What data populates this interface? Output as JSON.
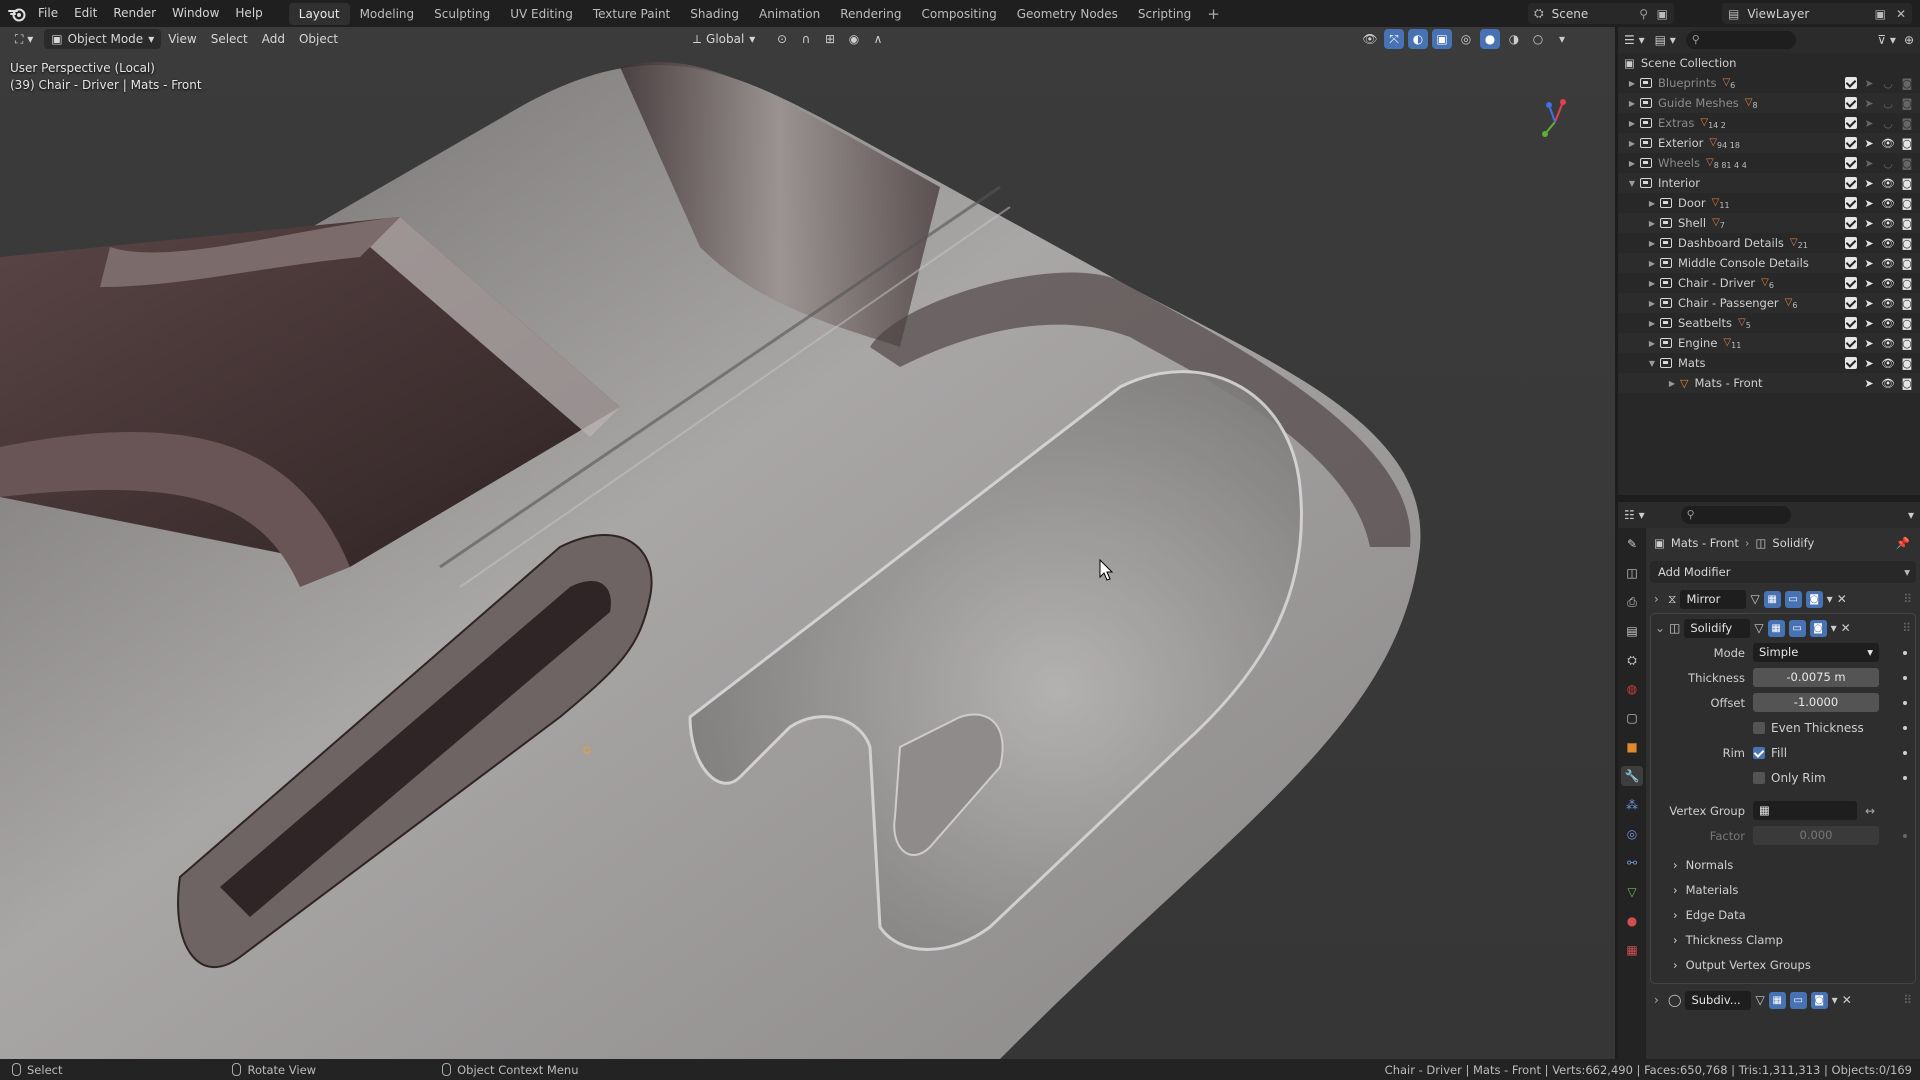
{
  "menu": {
    "items": [
      "File",
      "Edit",
      "Render",
      "Window",
      "Help"
    ]
  },
  "workspaces": [
    "Layout",
    "Modeling",
    "Sculpting",
    "UV Editing",
    "Texture Paint",
    "Shading",
    "Animation",
    "Rendering",
    "Compositing",
    "Geometry Nodes",
    "Scripting"
  ],
  "active_workspace": "Layout",
  "scene": {
    "name": "Scene",
    "view_layer": "ViewLayer"
  },
  "viewport": {
    "mode": "Object Mode",
    "menus": [
      "View",
      "Select",
      "Add",
      "Object"
    ],
    "orientation": "Global",
    "perspective_label": "User Perspective (Local)",
    "object_label": "(39) Chair - Driver | Mats - Front"
  },
  "outliner": {
    "title": "Scene Collection",
    "rows": [
      {
        "name": "Blueprints",
        "badge": "6",
        "dim": true,
        "indent": 0
      },
      {
        "name": "Guide Meshes",
        "badge": "8",
        "dim": true,
        "indent": 0
      },
      {
        "name": "Extras",
        "badge": "14  2",
        "dim": true,
        "indent": 0
      },
      {
        "name": "Exterior",
        "badge": "94 18",
        "dim": false,
        "indent": 0
      },
      {
        "name": "Wheels",
        "badge": "8 81 4 4",
        "dim": true,
        "indent": 0
      },
      {
        "name": "Interior",
        "badge": "",
        "dim": false,
        "indent": 0,
        "expanded": true
      },
      {
        "name": "Door",
        "badge": "11",
        "dim": false,
        "indent": 1
      },
      {
        "name": "Shell",
        "badge": "7",
        "dim": false,
        "indent": 1
      },
      {
        "name": "Dashboard Details",
        "badge": "21",
        "dim": false,
        "indent": 1
      },
      {
        "name": "Middle Console Details",
        "badge": "",
        "dim": false,
        "indent": 1
      },
      {
        "name": "Chair - Driver",
        "badge": "6",
        "dim": false,
        "indent": 1
      },
      {
        "name": "Chair - Passenger",
        "badge": "6",
        "dim": false,
        "indent": 1
      },
      {
        "name": "Seatbelts",
        "badge": "5",
        "dim": false,
        "indent": 1
      },
      {
        "name": "Engine",
        "badge": "11",
        "dim": false,
        "indent": 1
      },
      {
        "name": "Mats",
        "badge": "",
        "dim": false,
        "indent": 1,
        "expanded": true
      },
      {
        "name": "Mats - Front",
        "badge": "",
        "dim": false,
        "indent": 2,
        "object": true
      }
    ]
  },
  "properties": {
    "object": "Mats - Front",
    "modifier_context": "Solidify",
    "add_modifier": "Add Modifier",
    "modifiers": [
      "Mirror",
      "Solidify",
      "Subdiv..."
    ],
    "solidify": {
      "mode_label": "Mode",
      "mode_value": "Simple",
      "thickness_label": "Thickness",
      "thickness_value": "-0.0075 m",
      "offset_label": "Offset",
      "offset_value": "-1.0000",
      "even_thickness": "Even Thickness",
      "rim_label": "Rim",
      "fill": "Fill",
      "only_rim": "Only Rim",
      "vertex_group_label": "Vertex Group",
      "factor_label": "Factor",
      "factor_value": "0.000",
      "subpanels": [
        "Normals",
        "Materials",
        "Edge Data",
        "Thickness Clamp",
        "Output Vertex Groups"
      ]
    }
  },
  "statusbar": {
    "select": "Select",
    "rotate": "Rotate View",
    "context": "Object Context Menu",
    "stats": "Chair - Driver | Mats - Front | Verts:662,490 | Faces:650,768 | Tris:1,311,313 | Objects:0/169"
  },
  "colors": {
    "accent": "#4772b3",
    "badge": "#e08040",
    "background": "#393939"
  }
}
